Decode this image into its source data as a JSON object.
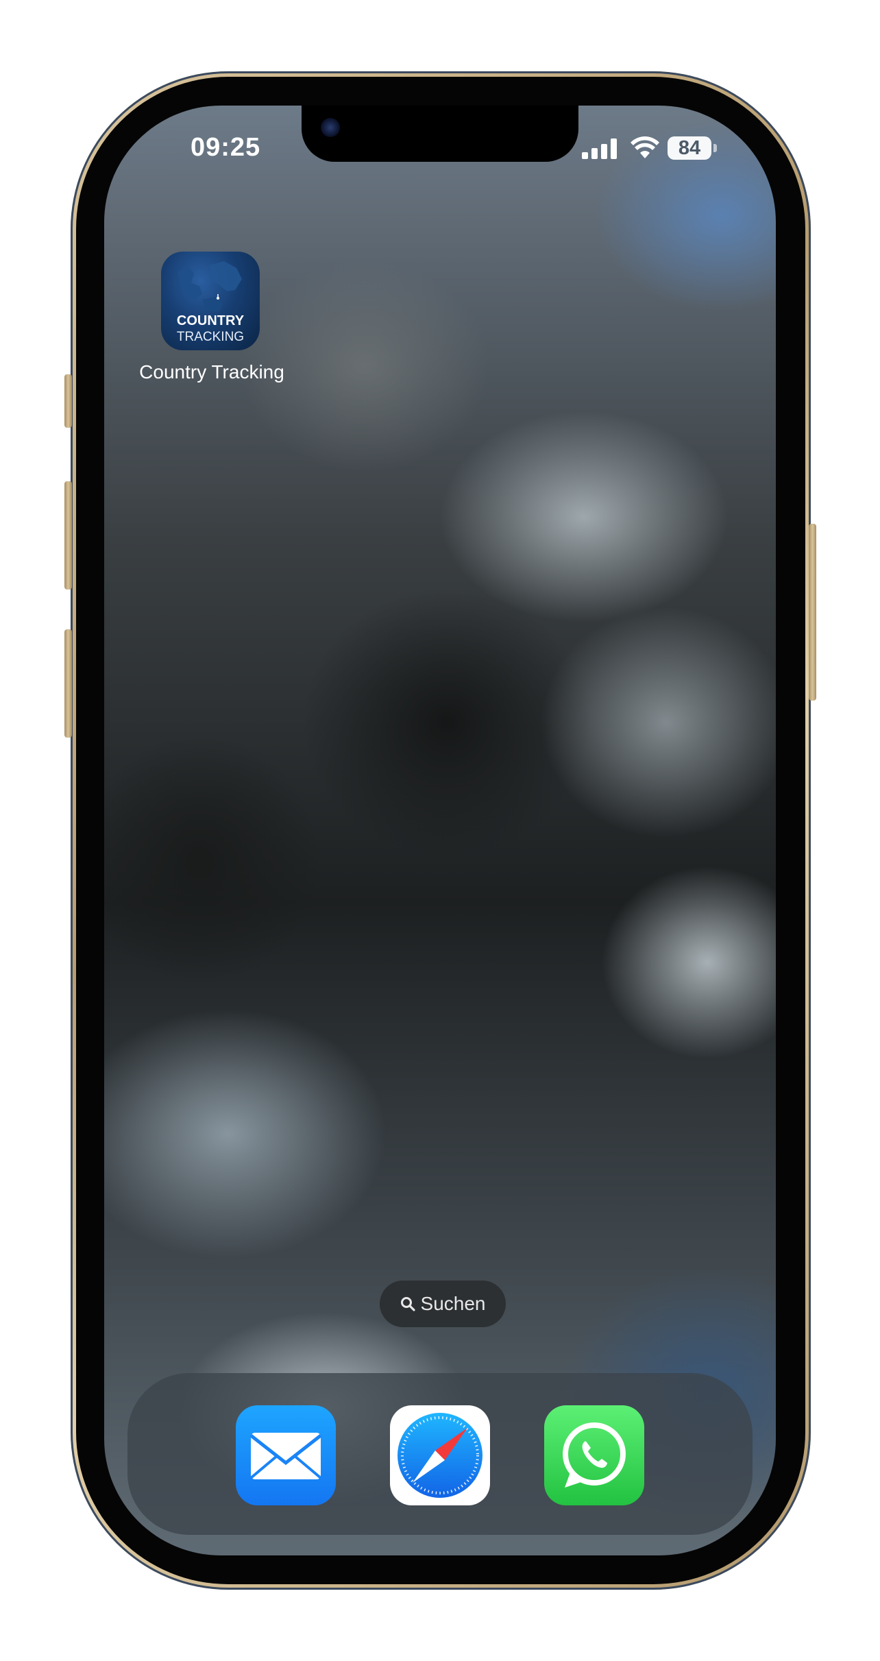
{
  "status_bar": {
    "time": "09:25",
    "battery_percent": "84",
    "cellular_bars": 4,
    "wifi": "wifi-icon"
  },
  "home_screen": {
    "apps": [
      {
        "label": "Country Tracking",
        "icon_line1": "COUNTRY",
        "icon_line2": "TRACKING",
        "icon": "map-icon"
      }
    ],
    "search_label": "Suchen"
  },
  "dock": {
    "apps": [
      {
        "name": "mail",
        "icon": "mail-icon",
        "color": "#1476f2"
      },
      {
        "name": "safari",
        "icon": "safari-compass-icon",
        "color": "#1a8cff"
      },
      {
        "name": "whatsapp",
        "icon": "whatsapp-icon",
        "color": "#23c241"
      }
    ]
  },
  "frame_color": "#c9b086"
}
